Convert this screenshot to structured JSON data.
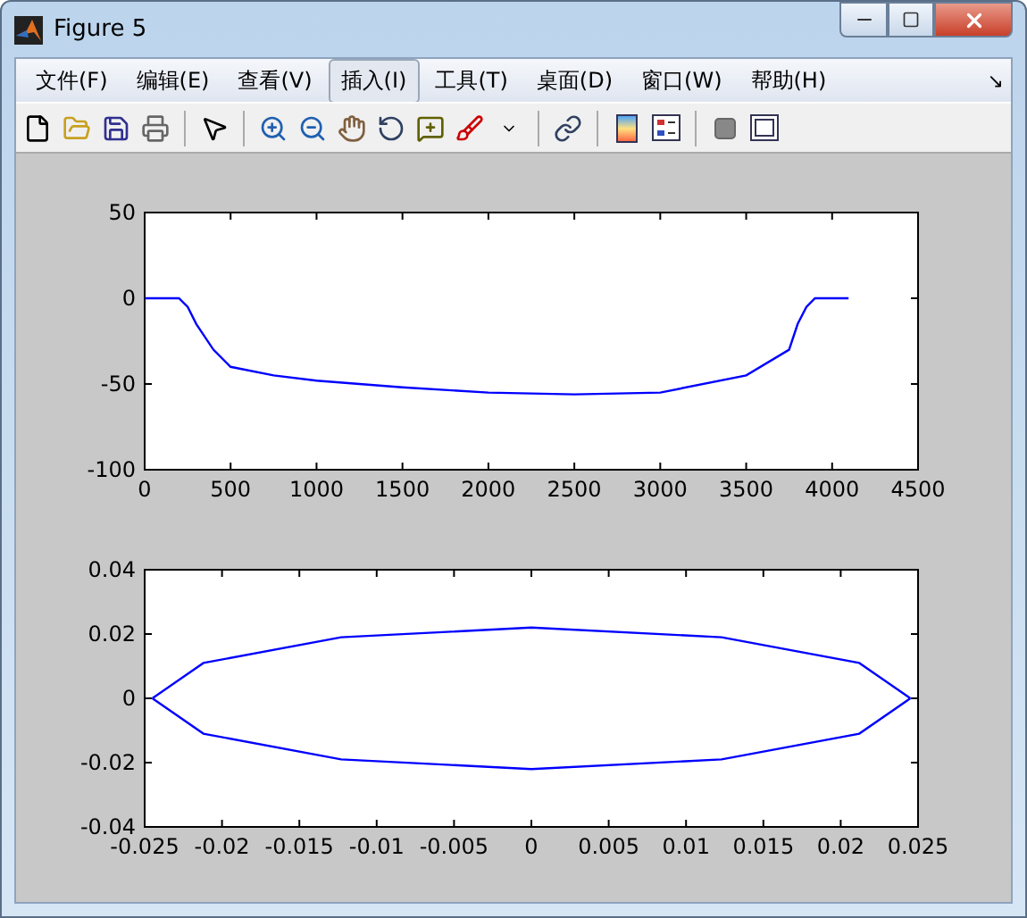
{
  "window": {
    "title": "Figure 5"
  },
  "menu": [
    {
      "label": "文件(F)",
      "selected": false
    },
    {
      "label": "编辑(E)",
      "selected": false
    },
    {
      "label": "查看(V)",
      "selected": false
    },
    {
      "label": "插入(I)",
      "selected": true
    },
    {
      "label": "工具(T)",
      "selected": false
    },
    {
      "label": "桌面(D)",
      "selected": false
    },
    {
      "label": "窗口(W)",
      "selected": false
    },
    {
      "label": "帮助(H)",
      "selected": false
    }
  ],
  "menu_overflow": "↘",
  "plots": [
    {
      "chart_data": {
        "type": "line",
        "xlim": [
          0,
          4500
        ],
        "ylim": [
          -100,
          50
        ],
        "xticks": [
          0,
          500,
          1000,
          1500,
          2000,
          2500,
          3000,
          3500,
          4000,
          4500
        ],
        "yticks": [
          -100,
          -50,
          0,
          50
        ],
        "x": [
          0,
          200,
          250,
          300,
          400,
          500,
          750,
          1000,
          1500,
          2000,
          2500,
          3000,
          3500,
          3750,
          3800,
          3850,
          3900,
          4096
        ],
        "series": [
          {
            "color": "#0000ff",
            "values": [
              0,
              0,
              -5,
              -15,
              -30,
              -40,
              -45,
              -48,
              -52,
              -55,
              -56,
              -55,
              -45,
              -30,
              -15,
              -5,
              0,
              0
            ]
          }
        ]
      }
    },
    {
      "chart_data": {
        "type": "line",
        "xlim": [
          -0.025,
          0.025
        ],
        "ylim": [
          -0.04,
          0.04
        ],
        "xticks": [
          {
            "value": -0.025,
            "label": "-0.025"
          },
          {
            "value": -0.02,
            "label": "-0.02"
          },
          {
            "value": -0.015,
            "label": "-0.015"
          },
          {
            "value": -0.01,
            "label": "-0.01"
          },
          {
            "value": -0.005,
            "label": "-0.005"
          },
          {
            "value": 0,
            "label": "0"
          },
          {
            "value": 0.005,
            "label": "0.005"
          },
          {
            "value": 0.01,
            "label": "0.01"
          },
          {
            "value": 0.015,
            "label": "0.015"
          },
          {
            "value": 0.02,
            "label": "0.02"
          },
          {
            "value": 0.025,
            "label": "0.025"
          }
        ],
        "yticks": [
          {
            "value": -0.04,
            "label": "-0.04"
          },
          {
            "value": -0.02,
            "label": "-0.02"
          },
          {
            "value": 0,
            "label": "0"
          },
          {
            "value": 0.02,
            "label": "0.02"
          },
          {
            "value": 0.04,
            "label": "0.04"
          }
        ],
        "x": [
          -0.0245,
          -0.0212,
          -0.0123,
          0,
          0.0123,
          0.0212,
          0.0245
        ],
        "series": [
          {
            "color": "#0000ff",
            "values": [
              0,
              0.011,
              0.019,
              0.022,
              0.019,
              0.011,
              0
            ]
          },
          {
            "color": "#0000ff",
            "values": [
              0,
              -0.011,
              -0.019,
              -0.022,
              -0.019,
              -0.011,
              0
            ]
          }
        ]
      }
    }
  ]
}
